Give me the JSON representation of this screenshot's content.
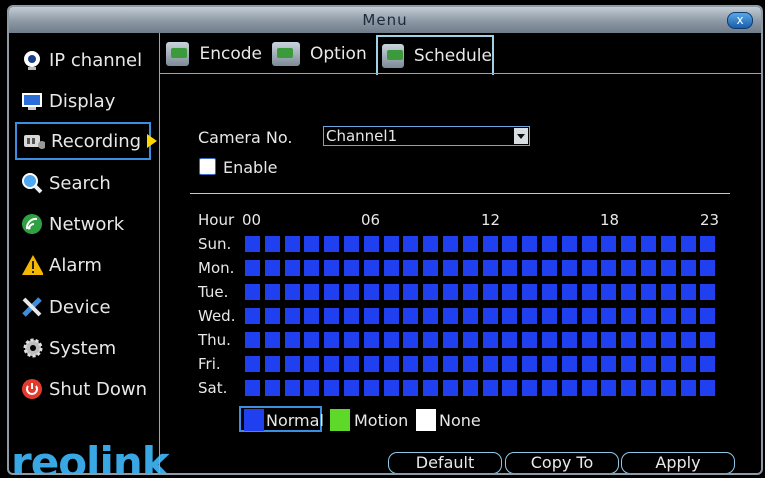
{
  "window": {
    "title": "Menu",
    "close_label": "x"
  },
  "sidebar": {
    "items": [
      {
        "label": "IP channel",
        "icon": "webcam-icon"
      },
      {
        "label": "Display",
        "icon": "monitor-icon"
      },
      {
        "label": "Recording",
        "icon": "recorder-icon",
        "active": true
      },
      {
        "label": "Search",
        "icon": "magnifier-icon"
      },
      {
        "label": "Network",
        "icon": "network-icon"
      },
      {
        "label": "Alarm",
        "icon": "warning-icon"
      },
      {
        "label": "Device",
        "icon": "tools-icon"
      },
      {
        "label": "System",
        "icon": "gear-icon"
      },
      {
        "label": "Shut Down",
        "icon": "power-icon"
      }
    ],
    "logo": "reolink"
  },
  "tabs": [
    {
      "label": "Encode"
    },
    {
      "label": "Option"
    },
    {
      "label": "Schedule",
      "active": true
    }
  ],
  "form": {
    "camera_label": "Camera No.",
    "camera_value": "Channel1",
    "enable_label": "Enable",
    "enable_checked": false
  },
  "schedule": {
    "hour_label": "Hour",
    "hour_ticks": [
      "00",
      "06",
      "12",
      "18",
      "23"
    ],
    "days": [
      "Sun.",
      "Mon.",
      "Tue.",
      "Wed.",
      "Thu.",
      "Fri.",
      "Sat."
    ],
    "hours_per_day": 24,
    "fill_mode": "Normal",
    "normal_color": "#2040f0"
  },
  "legend": [
    {
      "label": "Normal",
      "color": "#2040f0",
      "selected": true
    },
    {
      "label": "Motion",
      "color": "#5ed92a"
    },
    {
      "label": "None",
      "color": "#ffffff"
    }
  ],
  "buttons": {
    "default": "Default",
    "copy_to": "Copy To",
    "apply": "Apply"
  }
}
